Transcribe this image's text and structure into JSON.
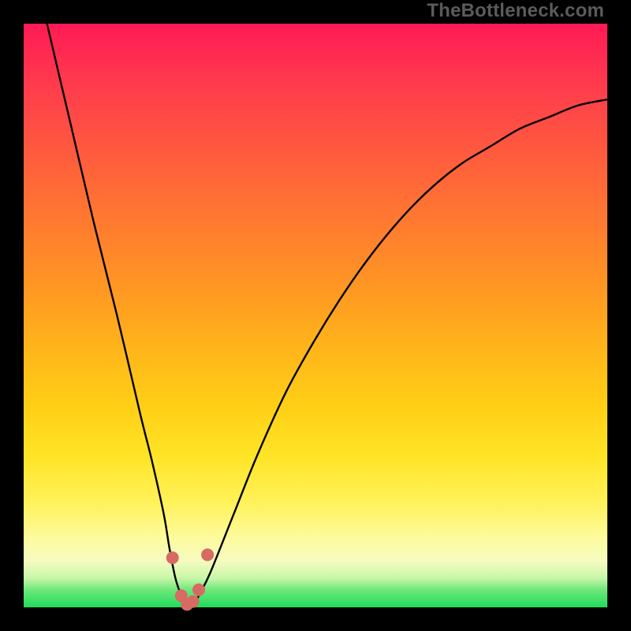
{
  "watermark": "TheBottleneck.com",
  "colors": {
    "background": "#000000",
    "curve": "#000000",
    "dots": "#d76a63",
    "gradient_top": "#ff1a55",
    "gradient_bottom": "#1fdc5a"
  },
  "chart_data": {
    "type": "line",
    "title": "",
    "xlabel": "",
    "ylabel": "",
    "xlim": [
      0,
      100
    ],
    "ylim": [
      0,
      100
    ],
    "grid": false,
    "note": "Bottleneck V-curve. X is relative hardware balance (arbitrary units), Y is bottleneck percentage. Values estimated from pixel positions; no axis ticks are rendered in the source image.",
    "x": [
      4,
      8,
      12,
      16,
      20,
      22,
      24,
      25,
      26,
      27,
      28,
      29,
      30,
      32,
      36,
      40,
      45,
      50,
      55,
      60,
      65,
      70,
      75,
      80,
      85,
      90,
      95,
      100
    ],
    "values": [
      100,
      83,
      66,
      50,
      33,
      25,
      16,
      10,
      5,
      2,
      0,
      0,
      2,
      6,
      16,
      26,
      37,
      46,
      54,
      61,
      67,
      72,
      76,
      79,
      82,
      84,
      86,
      87
    ],
    "valley_x_range": [
      27.5,
      29.5
    ],
    "dots": [
      {
        "x": 25.5,
        "y": 8.5
      },
      {
        "x": 27.0,
        "y": 2.0
      },
      {
        "x": 28.0,
        "y": 0.5
      },
      {
        "x": 29.0,
        "y": 1.0
      },
      {
        "x": 30.0,
        "y": 3.0
      },
      {
        "x": 31.5,
        "y": 9.0
      }
    ],
    "dot_radius_px": 8
  }
}
